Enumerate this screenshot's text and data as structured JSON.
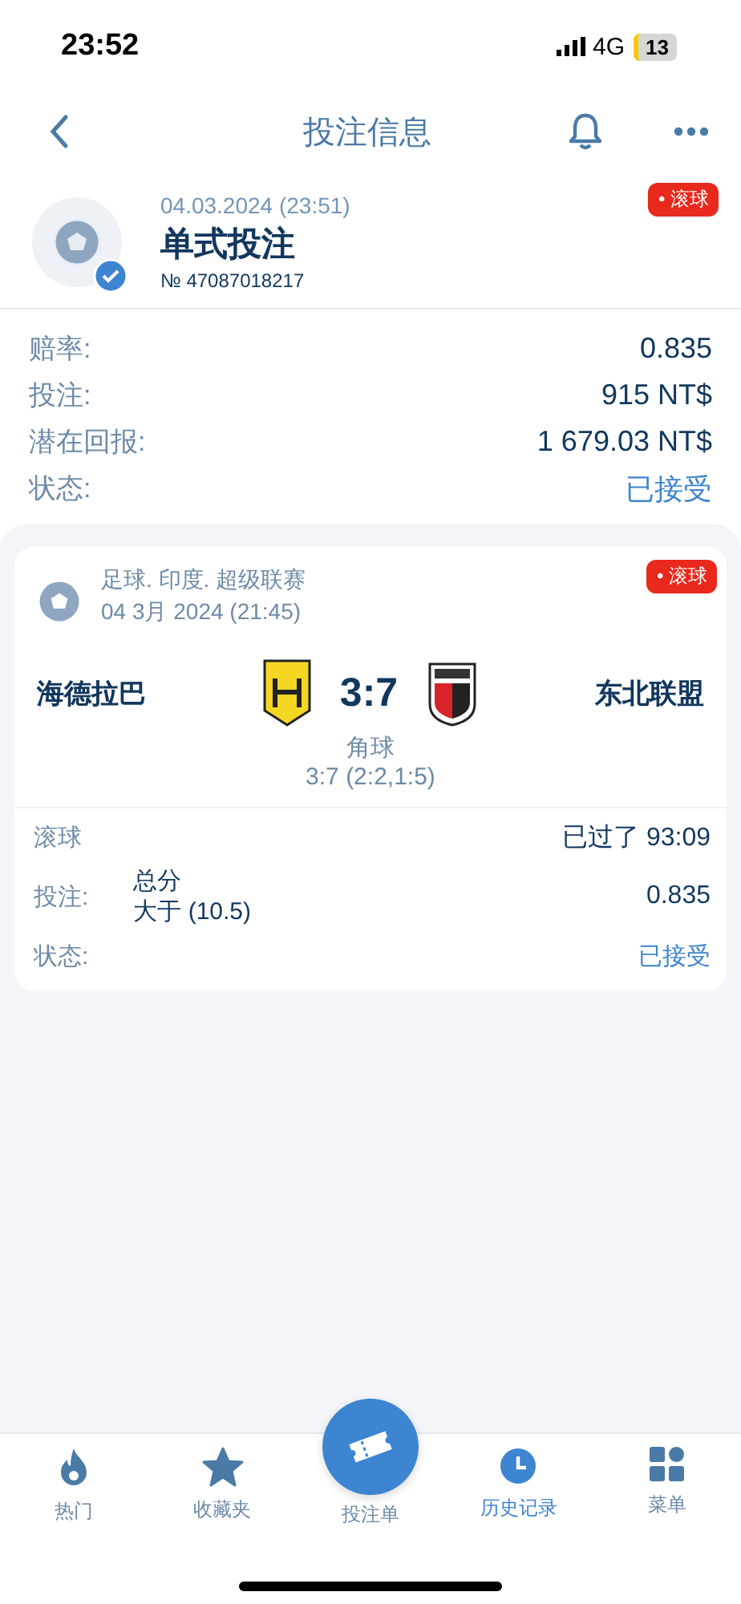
{
  "status_bar": {
    "time": "23:52",
    "network": "4G",
    "battery": "13"
  },
  "header": {
    "title": "投注信息"
  },
  "bet": {
    "date": "04.03.2024 (23:51)",
    "type": "单式投注",
    "number": "№ 47087018217",
    "badge": "• 滚球"
  },
  "summary": [
    {
      "label": "赔率:",
      "value": "0.835",
      "kind": "plain"
    },
    {
      "label": "投注:",
      "value": "915 NT$",
      "kind": "plain"
    },
    {
      "label": "潜在回报:",
      "value": "1 679.03 NT$",
      "kind": "plain"
    },
    {
      "label": "状态:",
      "value": "已接受",
      "kind": "status"
    }
  ],
  "match": {
    "league": "足球. 印度. 超级联赛",
    "date": "04 3月 2024 (21:45)",
    "badge": "• 滚球",
    "home": "海德拉巴",
    "score": "3:7",
    "away": "东北联盟",
    "stat_name": "角球",
    "stat_detail": "3:7 (2:2,1:5)"
  },
  "details": {
    "live_label": "滚球",
    "elapsed": "已过了 93:09",
    "bet_label": "投注:",
    "market": "总分",
    "pick": "大于 (10.5)",
    "odds": "0.835",
    "status_label": "状态:",
    "status": "已接受"
  },
  "nav": [
    {
      "label": "热门",
      "kind": "fire",
      "selected": false
    },
    {
      "label": "收藏夹",
      "kind": "star",
      "selected": false
    },
    {
      "label": "投注单",
      "kind": "ticket",
      "selected": false
    },
    {
      "label": "历史记录",
      "kind": "clock",
      "selected": true
    },
    {
      "label": "菜单",
      "kind": "grid",
      "selected": false
    }
  ]
}
